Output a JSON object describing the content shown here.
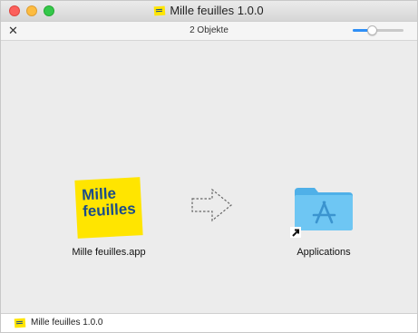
{
  "window": {
    "title": "Mille feuilles 1.0.0"
  },
  "toolbar": {
    "item_count": "2 Objekte",
    "icon_size_slider": {
      "value": 0.35
    }
  },
  "items": {
    "app": {
      "label": "Mille feuilles.app",
      "icon_line1": "Mille",
      "icon_line2": "feuilles",
      "icon_color": "#ffe500",
      "icon_text_color": "#1b4d89"
    },
    "applications": {
      "label": "Applications",
      "icon": "applications-folder-icon",
      "folder_color": "#5bbcf0"
    }
  },
  "statusbar": {
    "path_label": "Mille feuilles 1.0.0"
  }
}
